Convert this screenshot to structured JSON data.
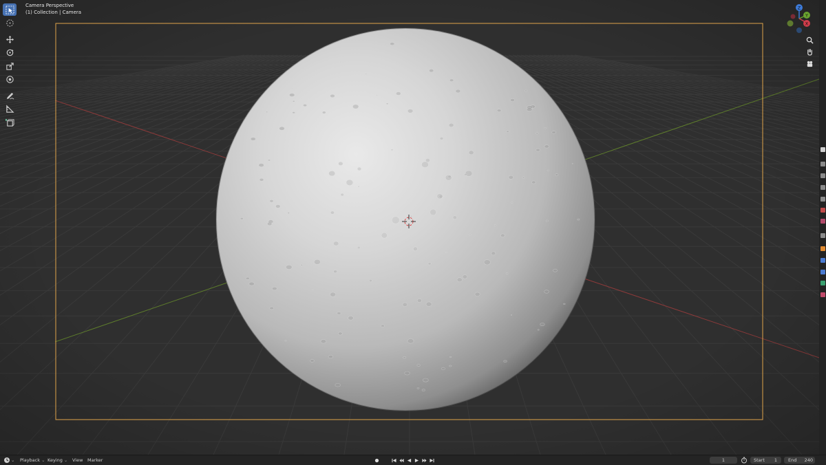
{
  "viewport": {
    "title": "Camera Perspective",
    "collection": "(1) Collection | Camera"
  },
  "toolbar": {
    "tools": [
      "select-box",
      "cursor",
      "move",
      "rotate",
      "scale",
      "transform",
      "annotate",
      "measure",
      "add-cube"
    ],
    "active_tool": "select-box"
  },
  "gizmo": {
    "axes": [
      "Z",
      "Y",
      "X"
    ]
  },
  "nav_tools": [
    "zoom-icon",
    "hand-pan-icon",
    "camera-view-icon"
  ],
  "timeline": {
    "menus": [
      "Playback",
      "Keying",
      "View",
      "Marker"
    ],
    "current_frame": "1",
    "start_label": "Start",
    "start_value": "1",
    "end_label": "End",
    "end_value": "240"
  },
  "colors": {
    "accent": "#4772b3",
    "camera_frame": "#e0a44a",
    "x_axis": "#8c3a3a",
    "y_axis": "#5e7d2c",
    "grid": "#3b3b3b"
  }
}
